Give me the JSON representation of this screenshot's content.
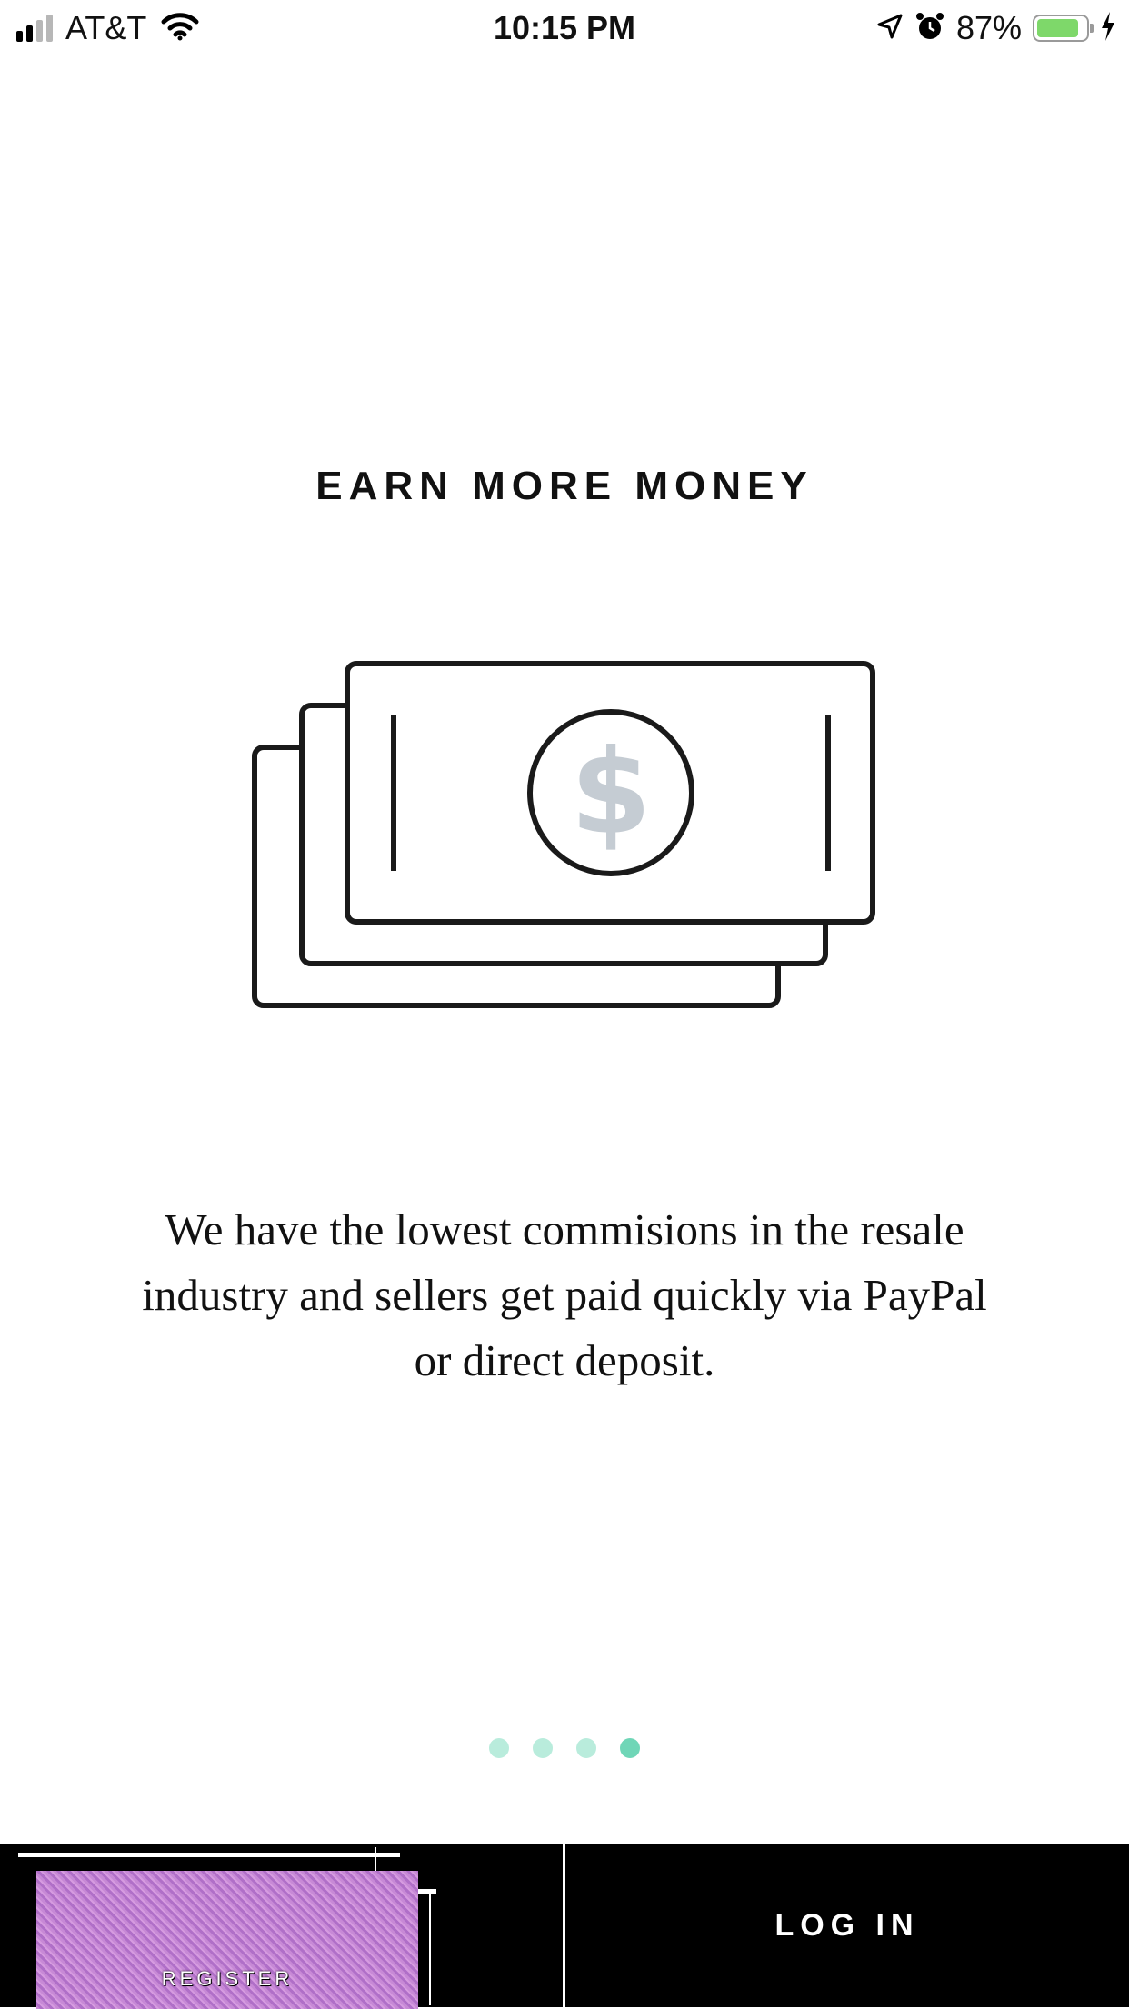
{
  "status_bar": {
    "carrier": "AT&T",
    "time": "10:15 PM",
    "battery_percent": "87%",
    "battery_level": 0.87,
    "signal_bars": 2,
    "icons": [
      "signal-icon",
      "wifi-icon",
      "location-icon",
      "alarm-icon",
      "battery-icon",
      "charging-icon"
    ]
  },
  "onboarding": {
    "title": "EARN MORE MONEY",
    "illustration": "money-stack-icon",
    "description": "We have the lowest commisions in the resale industry and sellers get paid quickly via PayPal or direct deposit.",
    "pages": 4,
    "active_page": 4
  },
  "actions": {
    "register_label": "REGISTER",
    "login_label": "LOG IN"
  },
  "colors": {
    "dot_inactive": "#b9ecdc",
    "dot_active": "#6fd6b7",
    "bill_stroke": "#1a1a1a",
    "dollar_sign": "#c5ccd3",
    "bottom_bar": "#000000",
    "battery_fill": "#7ed86a"
  }
}
